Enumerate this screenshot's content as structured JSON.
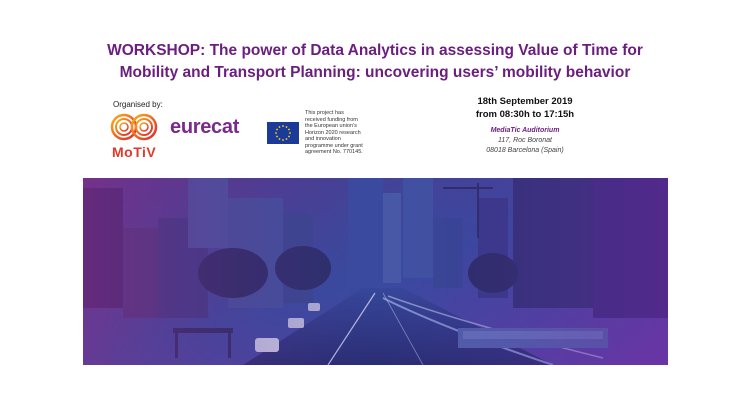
{
  "title": {
    "line1": "WORKSHOP: The power of Data Analytics in assessing Value of Time for",
    "line2": "Mobility and Transport Planning: uncovering users’ mobility behavior"
  },
  "organised_label": "Organised by:",
  "logos": {
    "motiv": "MoTiV",
    "eurecat": "eurecat",
    "eu_funding_text": "This project has received funding from the European union’s Horizon 2020 research and innovation programme under grant agreement No. 770145."
  },
  "event": {
    "date": "18th September 2019",
    "time": "from 08:30h to 17:15h",
    "venue": "MediaTic Auditorium",
    "address_line1": "117, Roc Boronat",
    "address_line2": "08018 Barcelona (Spain)"
  },
  "colors": {
    "title_purple": "#6a1e7e",
    "motiv_red": "#e03a2a",
    "eurecat_purple": "#7a2a8c",
    "eu_blue": "#1b3a9a"
  }
}
